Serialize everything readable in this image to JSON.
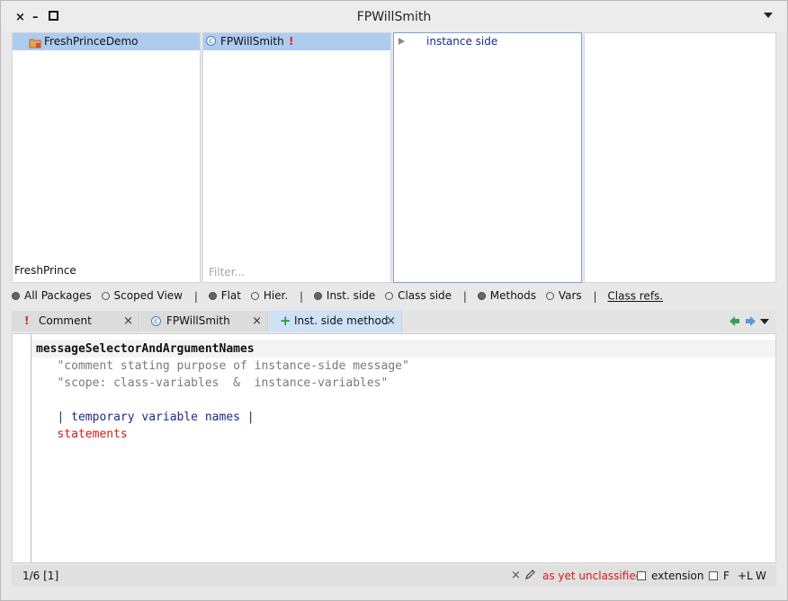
{
  "window": {
    "title": "FPWillSmith",
    "close_glyph": "×",
    "minimize_glyph": "–",
    "maximize_glyph": "□"
  },
  "packages": {
    "items": [
      "FreshPrinceDemo"
    ],
    "footer": "FreshPrince"
  },
  "classes": {
    "items": [
      {
        "label": "FPWillSmith",
        "badge": "!"
      }
    ],
    "filter_placeholder": "Filter..."
  },
  "protocols": {
    "items": [
      "instance side"
    ]
  },
  "options": {
    "all_packages": "All Packages",
    "scoped_view": "Scoped View",
    "flat": "Flat",
    "hier": "Hier.",
    "inst_side": "Inst. side",
    "class_side": "Class side",
    "methods": "Methods",
    "vars": "Vars",
    "class_refs": "Class refs.",
    "separator": "|"
  },
  "tabs": [
    {
      "label": "Comment",
      "icon": "!",
      "close": "×"
    },
    {
      "label": "FPWillSmith",
      "icon": "c",
      "close": "×"
    },
    {
      "label": "Inst. side method",
      "icon": "+",
      "close": "×"
    }
  ],
  "editor": {
    "lines": {
      "selector": "messageSelectorAndArgumentNames",
      "comment1": "   \"comment stating purpose of instance-side message\"",
      "comment2": "   \"scope: class-variables  &  instance-variables\"",
      "temps": "   | temporary variable names |",
      "statements": "   statements"
    }
  },
  "status": {
    "position": "1/6 [1]",
    "close_glyph": "×",
    "protocol": "as yet unclassified",
    "extension": "extension",
    "f": "F",
    "l": "+L",
    "w": "W"
  },
  "colors": {
    "selection": "#aecbf0",
    "unclassified": "#d41a1a",
    "temps": "#1c2a8c"
  }
}
